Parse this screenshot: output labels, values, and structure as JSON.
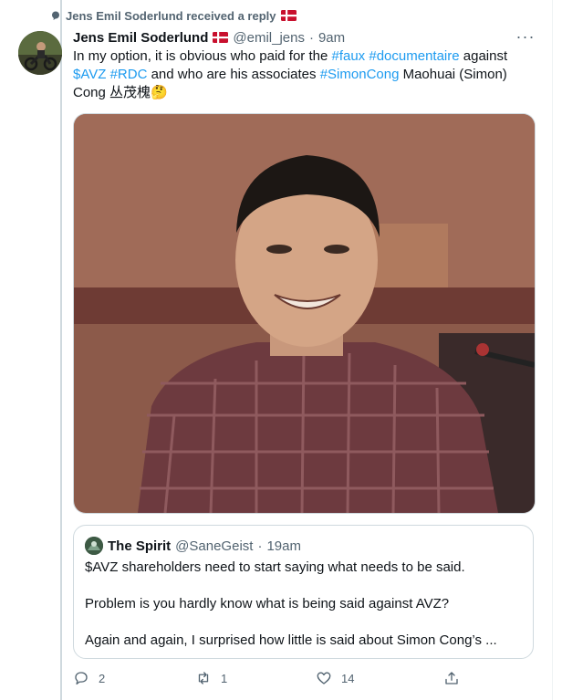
{
  "context": {
    "text": "Jens Emil Soderlund  received a reply"
  },
  "tweet": {
    "name": "Jens Emil Soderlund",
    "handle": "@emil_jens",
    "dot": "·",
    "time": "9am",
    "more_label": "···",
    "text_segments": [
      "In my option, it is obvious who paid for the ",
      "#faux",
      " ",
      "#documentaire",
      " against ",
      "$AVZ",
      " ",
      "#RDC",
      " and who are his associates  ",
      "#SimonCong",
      " Maohuai (Simon) Cong 丛茂槐🤔"
    ]
  },
  "quote": {
    "name": "The Spirit",
    "handle": "@SaneGeist",
    "dot": "·",
    "time": "19am",
    "lines": [
      "$AVZ shareholders need to start saying what needs to be said.",
      "Problem is you hardly know what is being said against AVZ?",
      "Again and again, I surprised how little is said about Simon Cong’s ..."
    ]
  },
  "actions": {
    "reply_count": "2",
    "retweet_count": "1",
    "like_count": "14"
  },
  "icons": {
    "reply": "reply-icon",
    "retweet": "retweet-icon",
    "like": "heart-icon",
    "share": "share-icon",
    "context": "speech-bubble-icon",
    "flag": "denmark-flag-icon"
  },
  "colors": {
    "link": "#1d9bf0",
    "secondary_text": "#536471",
    "border": "#cfd9de",
    "flag_red": "#c8102e"
  }
}
